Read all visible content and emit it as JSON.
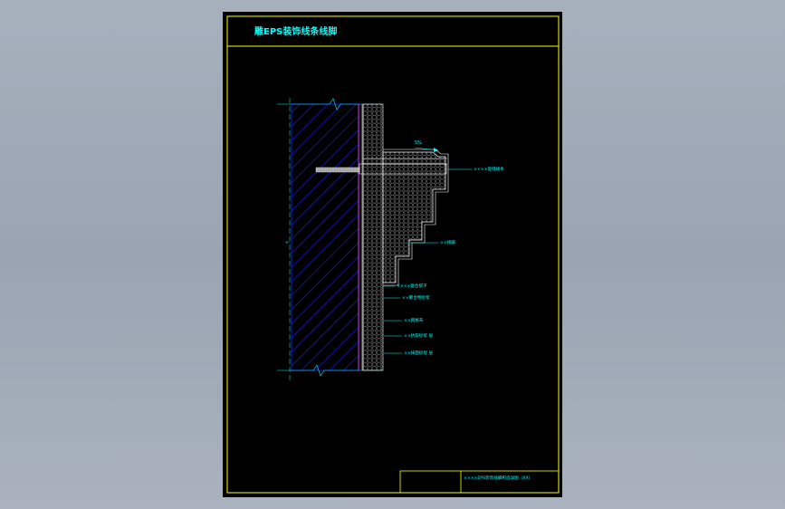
{
  "drawing": {
    "title": "雕EPS装饰线条线脚",
    "slope_label": "5%",
    "dimension_label": "≈",
    "callouts": [
      "××××嵌缝线条",
      "××线脚",
      "××××复合腻子",
      "××聚合物砂浆",
      "××网格布",
      "××抗裂砂浆 层",
      "××抹面砂浆 层"
    ],
    "title_block": {
      "caption": "××××EPS装饰线脚构造详图（XX）"
    }
  },
  "colors": {
    "sheet_border": "#ffff00",
    "annotation": "#00ffff",
    "wall_hatch": "#0000ff",
    "insulation_line": "#ffffff",
    "mesh_line": "#ff00ff",
    "background": "#000000"
  }
}
